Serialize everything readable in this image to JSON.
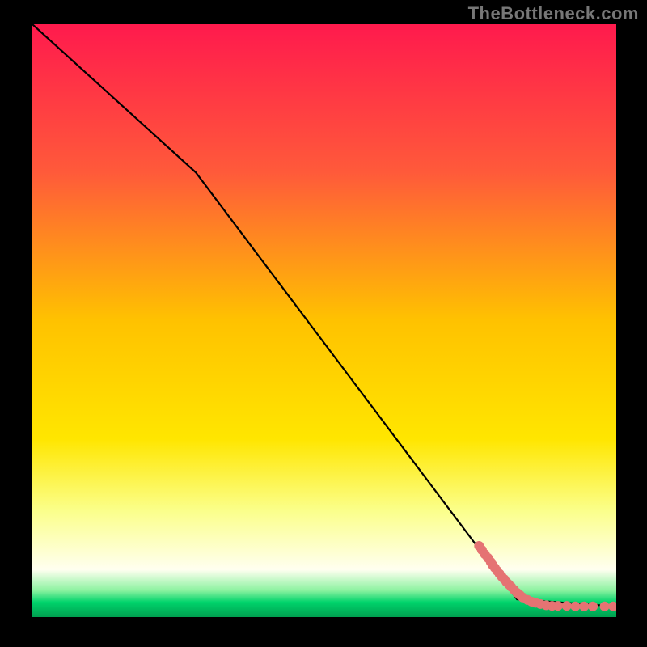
{
  "watermark": "TheBottleneck.com",
  "chart_data": {
    "type": "scatter",
    "title": "",
    "xlabel": "",
    "ylabel": "",
    "xlim": [
      0,
      100
    ],
    "ylim": [
      0,
      100
    ],
    "grid": false,
    "background_gradient_stops": [
      {
        "offset": 0.0,
        "color": "#ff1a4d"
      },
      {
        "offset": 0.25,
        "color": "#ff5a3a"
      },
      {
        "offset": 0.5,
        "color": "#ffc200"
      },
      {
        "offset": 0.7,
        "color": "#ffe600"
      },
      {
        "offset": 0.82,
        "color": "#fbff8a"
      },
      {
        "offset": 0.92,
        "color": "#fffff0"
      },
      {
        "offset": 0.955,
        "color": "#8cf2a0"
      },
      {
        "offset": 0.975,
        "color": "#00d36b"
      },
      {
        "offset": 1.0,
        "color": "#00a050"
      }
    ],
    "series": [
      {
        "name": "bottleneck-curve",
        "kind": "line",
        "color": "#000000",
        "points": [
          {
            "x": 0,
            "y": 100
          },
          {
            "x": 28,
            "y": 75
          },
          {
            "x": 83,
            "y": 3
          },
          {
            "x": 100,
            "y": 1.8
          }
        ]
      },
      {
        "name": "samples",
        "kind": "scatter",
        "color": "#e57373",
        "radius": 6,
        "x": [
          76.5,
          77.0,
          77.5,
          78.0,
          78.5,
          78.8,
          79.2,
          79.6,
          80.0,
          80.4,
          80.8,
          81.2,
          81.6,
          82.0,
          82.5,
          83.0,
          83.5,
          84.0,
          84.8,
          85.5,
          86.2,
          87.0,
          88.0,
          89.0,
          90.0,
          91.5,
          93.0,
          94.5,
          96.0,
          98.0,
          99.5
        ],
        "y": [
          12.0,
          11.3,
          10.6,
          10.0,
          9.3,
          8.8,
          8.3,
          7.8,
          7.3,
          6.8,
          6.4,
          5.9,
          5.5,
          5.1,
          4.6,
          4.1,
          3.7,
          3.3,
          2.9,
          2.6,
          2.4,
          2.2,
          2.0,
          1.9,
          1.9,
          1.9,
          1.8,
          1.8,
          1.8,
          1.8,
          1.8
        ]
      }
    ]
  }
}
